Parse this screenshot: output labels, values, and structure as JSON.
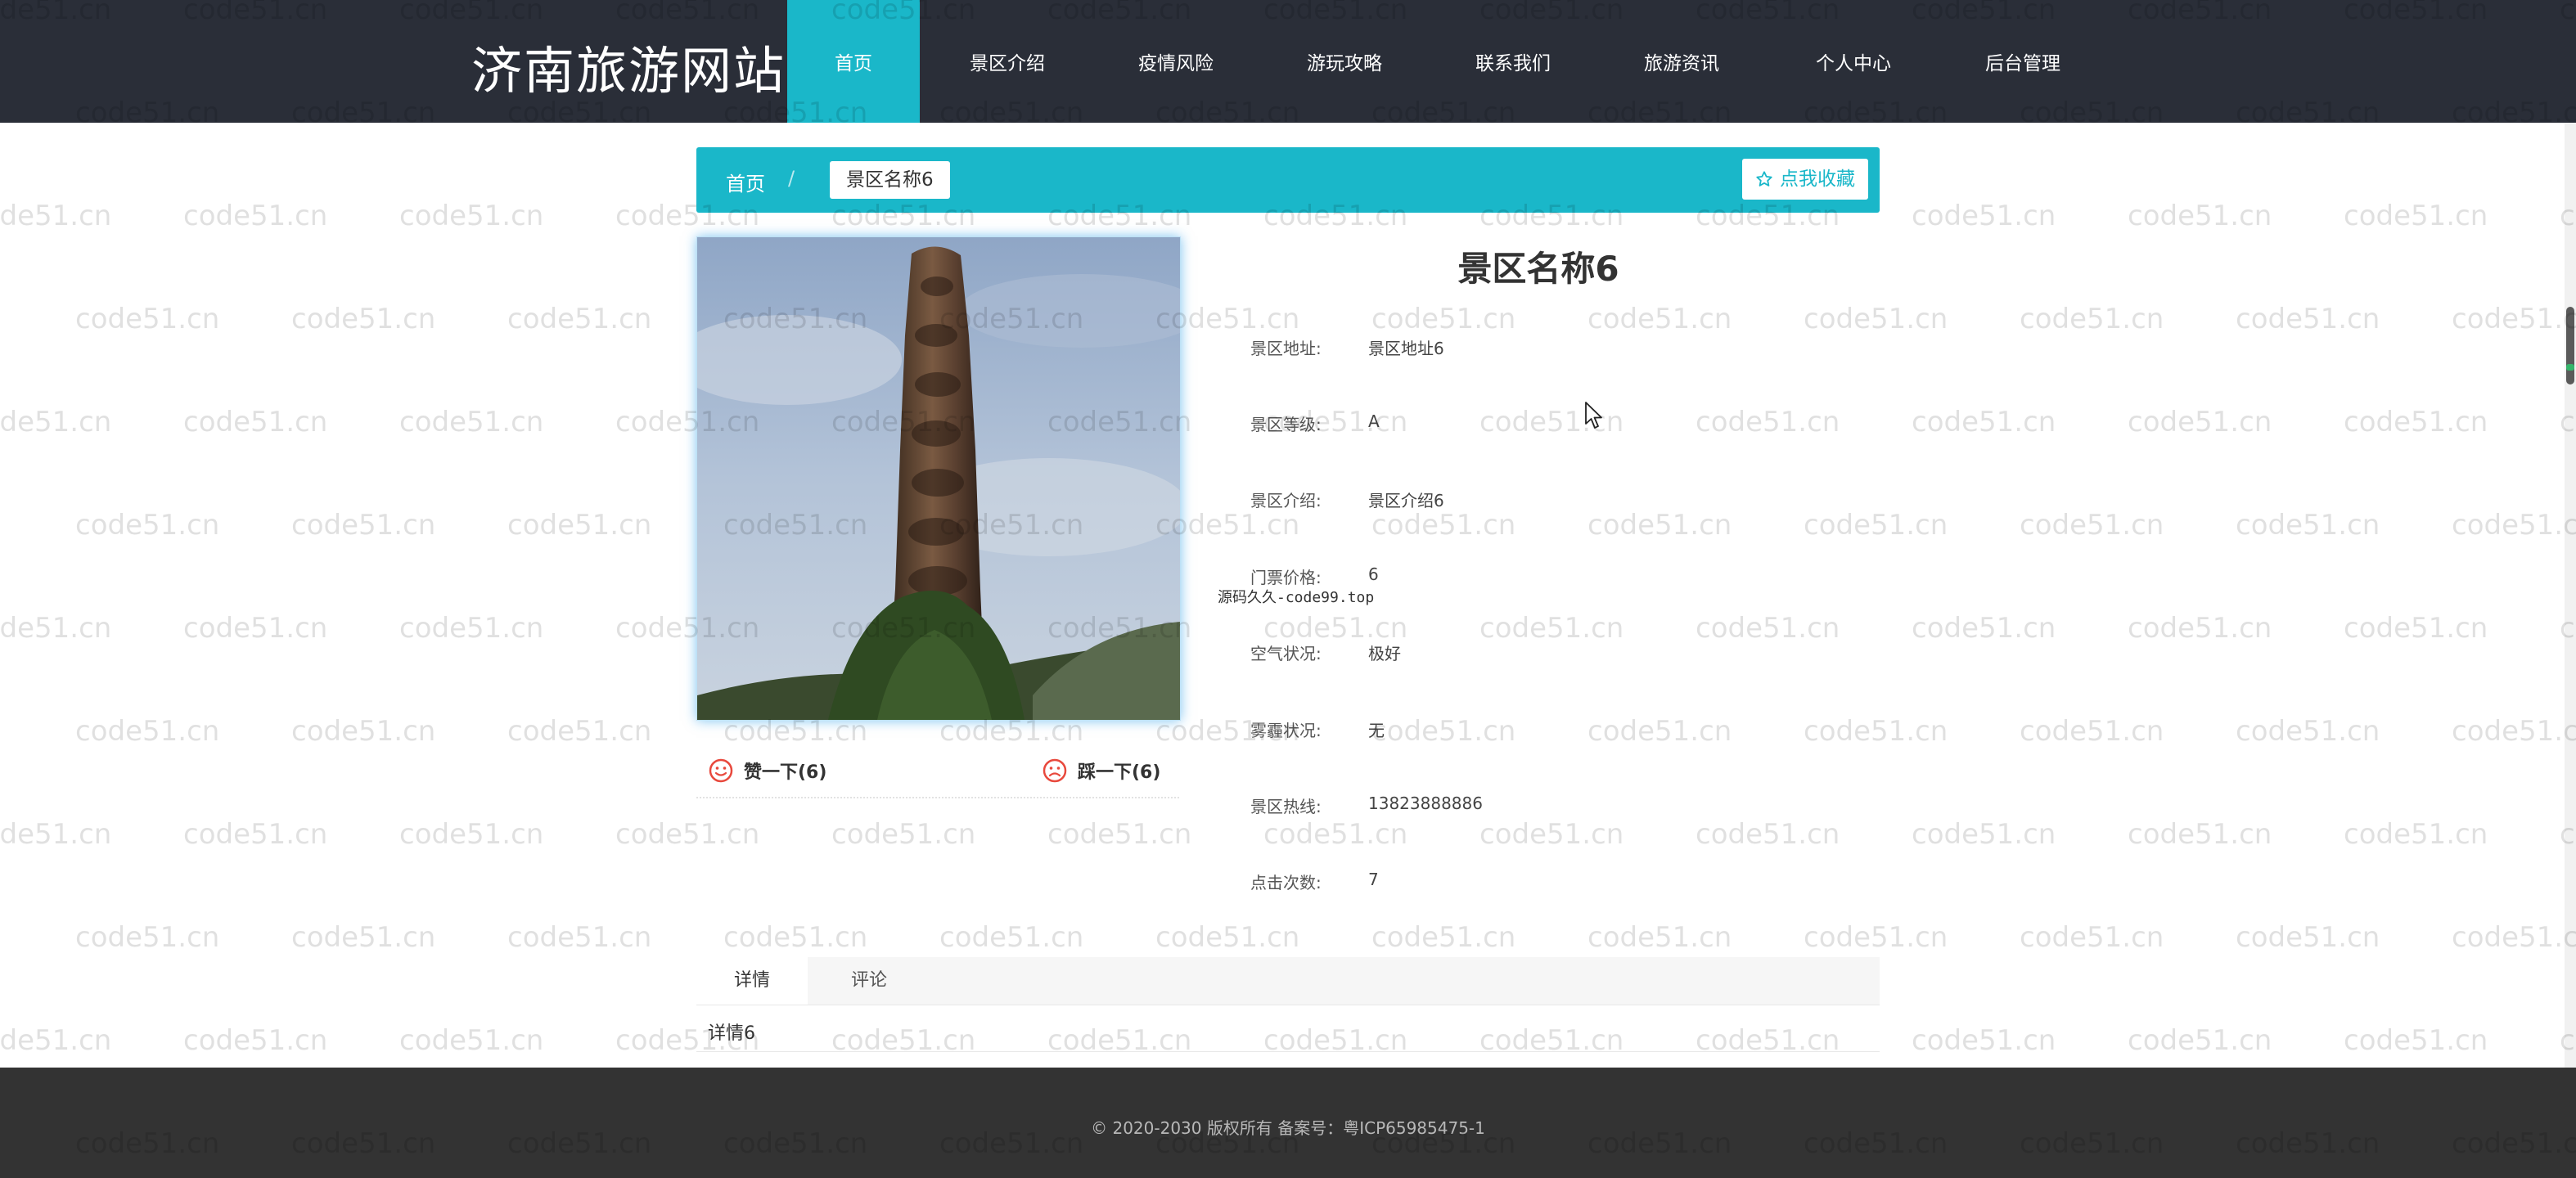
{
  "site": {
    "brand": "济南旅游网站"
  },
  "nav": {
    "items": [
      {
        "label": "首页",
        "active": true
      },
      {
        "label": "景区介绍",
        "active": false
      },
      {
        "label": "疫情风险",
        "active": false
      },
      {
        "label": "游玩攻略",
        "active": false
      },
      {
        "label": "联系我们",
        "active": false
      },
      {
        "label": "旅游资讯",
        "active": false
      },
      {
        "label": "个人中心",
        "active": false
      },
      {
        "label": "后台管理",
        "active": false
      }
    ]
  },
  "breadcrumb": {
    "home": "首页",
    "separator": "/",
    "current": "景区名称6"
  },
  "favorite": {
    "label": "点我收藏",
    "icon": "star-outline-icon"
  },
  "detail": {
    "title": "景区名称6",
    "fields": [
      {
        "label": "景区地址:",
        "value": "景区地址6"
      },
      {
        "label": "景区等级:",
        "value": "A"
      },
      {
        "label": "景区介绍:",
        "value": "景区介绍6"
      },
      {
        "label": "门票价格:",
        "value": "6"
      },
      {
        "label": "空气状况:",
        "value": "极好"
      },
      {
        "label": "雾霾状况:",
        "value": "无"
      },
      {
        "label": "景区热线:",
        "value": "13823888886"
      },
      {
        "label": "点击次数:",
        "value": "7"
      }
    ]
  },
  "votes": {
    "like": {
      "label": "赞一下(6)",
      "icon": "smile-icon"
    },
    "dislike": {
      "label": "踩一下(6)",
      "icon": "frown-icon"
    }
  },
  "stray_text": "源码久久-code99.top",
  "tabs": [
    {
      "label": "详情",
      "active": true
    },
    {
      "label": "评论",
      "active": false
    }
  ],
  "tab_content": "详情6",
  "footer": {
    "text": "© 2020-2030 版权所有 备案号：粤ICP65985475-1"
  },
  "watermark": {
    "text": "code51.cn"
  },
  "colors": {
    "accent": "#1ab7c9",
    "topbar": "#2a2e38",
    "footer": "#333333"
  }
}
